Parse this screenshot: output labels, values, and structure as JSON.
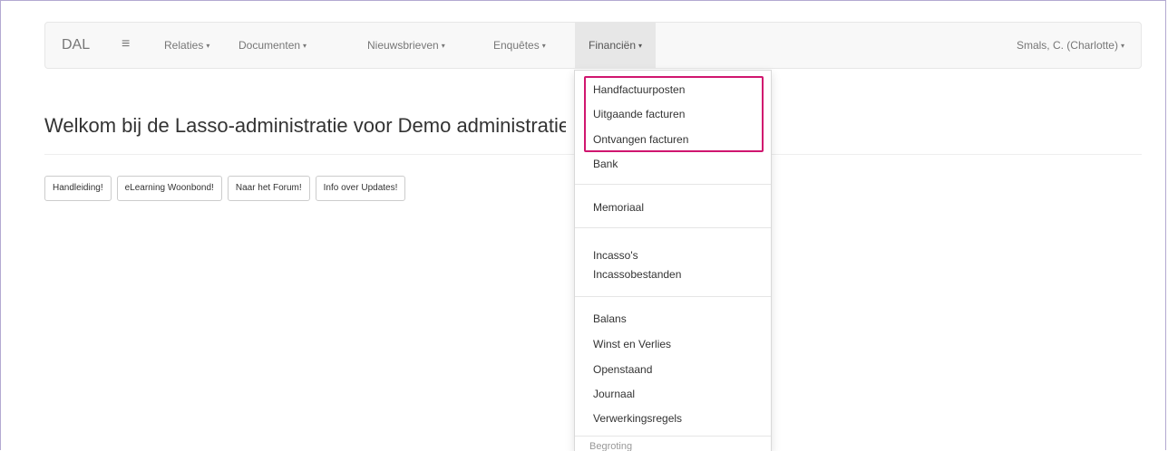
{
  "navbar": {
    "brand": "DAL",
    "menu_icon": "≡",
    "items": [
      {
        "label": "Relaties"
      },
      {
        "label": "Documenten"
      },
      {
        "label": "Nieuwsbrieven"
      },
      {
        "label": "Enquêtes"
      },
      {
        "label": "Financiën"
      }
    ],
    "user": "Smals, C. (Charlotte)",
    "caret": "▾"
  },
  "main": {
    "title": "Welkom bij de Lasso-administratie voor Demo administratie",
    "buttons": [
      {
        "label": "Handleiding!"
      },
      {
        "label": "eLearning Woonbond!"
      },
      {
        "label": "Naar het Forum!"
      },
      {
        "label": "Info over Updates!"
      }
    ]
  },
  "financien_menu": {
    "items": [
      "Handfactuurposten",
      "Uitgaande facturen",
      "Ontvangen facturen",
      "Bank",
      "Memoriaal",
      "Incasso's",
      "Incassobestanden",
      "Balans",
      "Winst en Verlies",
      "Openstaand",
      "Journaal",
      "Verwerkingsregels"
    ],
    "section_header": "Begroting"
  },
  "colors": {
    "highlight": "#d0166f",
    "navbar_bg": "#f8f8f8",
    "active_bg": "#e7e7e7"
  }
}
